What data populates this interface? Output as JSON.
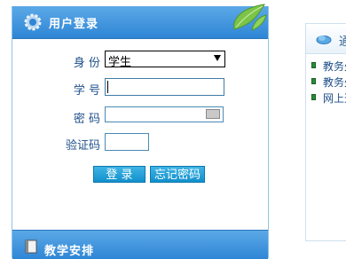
{
  "login": {
    "title": "用户登录",
    "identity_label": "身 份",
    "identity_value": "学生",
    "student_id_label": "学 号",
    "student_id_value": "",
    "password_label": "密 码",
    "password_value": "",
    "captcha_label": "验证码",
    "captcha_value": "",
    "login_button": "登 录",
    "forgot_button": "忘记密码"
  },
  "section": {
    "title": "教学安排"
  },
  "right_panel": {
    "title": "通",
    "items": [
      "教务处",
      "教务处",
      "网上选"
    ]
  },
  "icons": {
    "header_icon": "gear-icon",
    "section_icon": "book-icon",
    "right_icon": "cloud-icon",
    "keyboard_icon": "keyboard-icon"
  }
}
